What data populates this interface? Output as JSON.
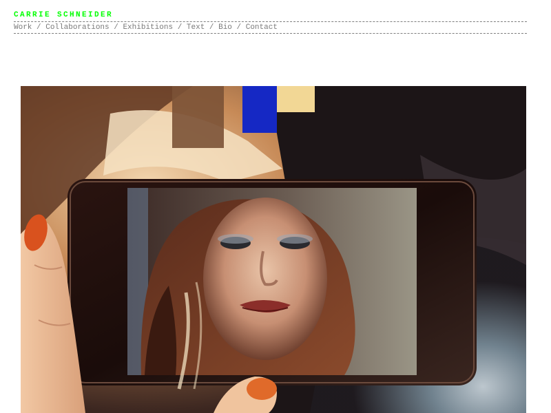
{
  "site": {
    "title": "CARRIE SCHNEIDER"
  },
  "nav": {
    "items": [
      {
        "label": "Work"
      },
      {
        "label": "Collaborations"
      },
      {
        "label": "Exhibitions"
      },
      {
        "label": "Text"
      },
      {
        "label": "Bio"
      },
      {
        "label": "Contact"
      }
    ],
    "separator": "/"
  },
  "colors": {
    "title": "#00ff00",
    "nav_text": "#7a7a7a",
    "rule": "#7c7c7c"
  },
  "hero_image": {
    "subject": "hand-holding-phone-with-film-still"
  }
}
